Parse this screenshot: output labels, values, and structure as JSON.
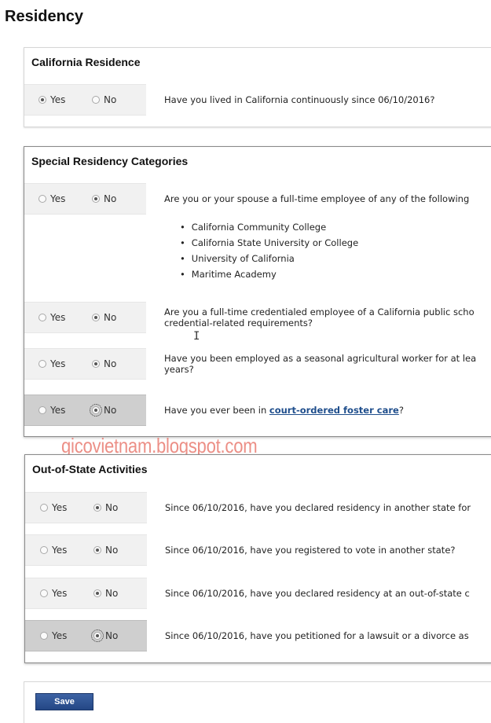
{
  "page": {
    "title": "Residency"
  },
  "watermark": "gicovietnam.blogspot.com",
  "options": {
    "yes": "Yes",
    "no": "No"
  },
  "california": {
    "title": "California Residence",
    "question": "Have you lived in California continuously since 06/10/2016?",
    "selected": "yes"
  },
  "special": {
    "title": "Special Residency Categories",
    "questions": [
      {
        "text": "Are you or your spouse a full-time employee of any of the following",
        "selected": "no"
      },
      {
        "text": "Are you a full-time credentialed employee of a California public scho credential-related requirements?",
        "selected": "no"
      },
      {
        "text": "Have you been employed as a seasonal agricultural worker for at lea years?",
        "selected": "no"
      },
      {
        "prefix": "Have you ever been in ",
        "link": "court-ordered foster care",
        "suffix": "?",
        "selected": "no"
      }
    ],
    "bullets": [
      "California Community College",
      "California State University or College",
      "University of California",
      "Maritime Academy"
    ]
  },
  "outofstate": {
    "title": "Out-of-State Activities",
    "questions": [
      {
        "text": "Since 06/10/2016, have you declared residency in another state for",
        "selected": "no"
      },
      {
        "text": "Since 06/10/2016, have you registered to vote in another state?",
        "selected": "no"
      },
      {
        "text": "Since 06/10/2016, have you declared residency at an out-of-state c",
        "selected": "no"
      },
      {
        "text": "Since 06/10/2016, have you petitioned for a lawsuit or a divorce as",
        "selected": "no"
      }
    ]
  },
  "footer": {
    "save_label": "Save"
  }
}
